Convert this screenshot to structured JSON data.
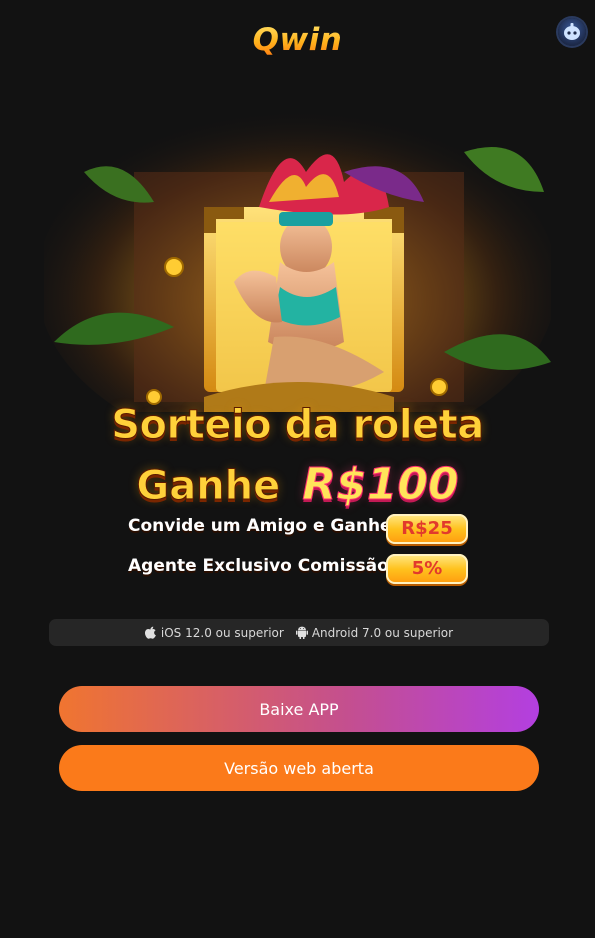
{
  "header": {
    "logo_text": "Qwin",
    "support_icon": "support-bot-icon"
  },
  "banner": {
    "line1": "Sorteio da roleta",
    "line2_word": "Ganhe",
    "line2_amount": "R$100",
    "rows": [
      {
        "text": "Convide um Amigo e Ganhe",
        "value": "R$25"
      },
      {
        "text": "Agente Exclusivo Comissão",
        "value": "5%"
      }
    ]
  },
  "requirements": {
    "ios_icon": "apple-icon",
    "ios": "iOS 12.0 ou superior",
    "android_icon": "android-icon",
    "android": "Android 7.0 ou superior"
  },
  "actions": {
    "download_label": "Baixe APP",
    "web_label": "Versão web aberta"
  },
  "colors": {
    "background": "#121212",
    "download_gradient_start": "#f07530",
    "download_gradient_end": "#b33fe0",
    "web_button": "#fb7a1a",
    "requirements_bar": "#262626"
  }
}
